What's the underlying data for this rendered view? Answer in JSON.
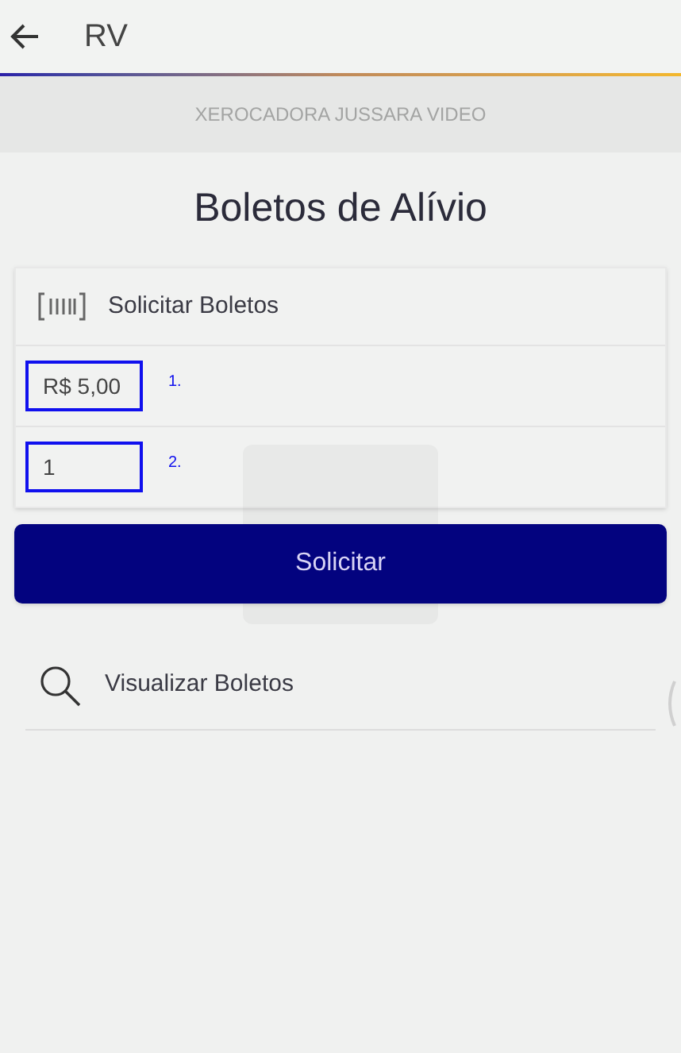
{
  "app_bar": {
    "title": "RV"
  },
  "banner": "XEROCADORA JUSSARA VIDEO",
  "page_title": "Boletos de Alívio",
  "request_card": {
    "title": "Solicitar Boletos",
    "fields": [
      {
        "value": "R$ 5,00",
        "annotation": "1."
      },
      {
        "value": "1",
        "annotation": "2."
      }
    ]
  },
  "submit_button": "Solicitar",
  "view_link": "Visualizar Boletos"
}
